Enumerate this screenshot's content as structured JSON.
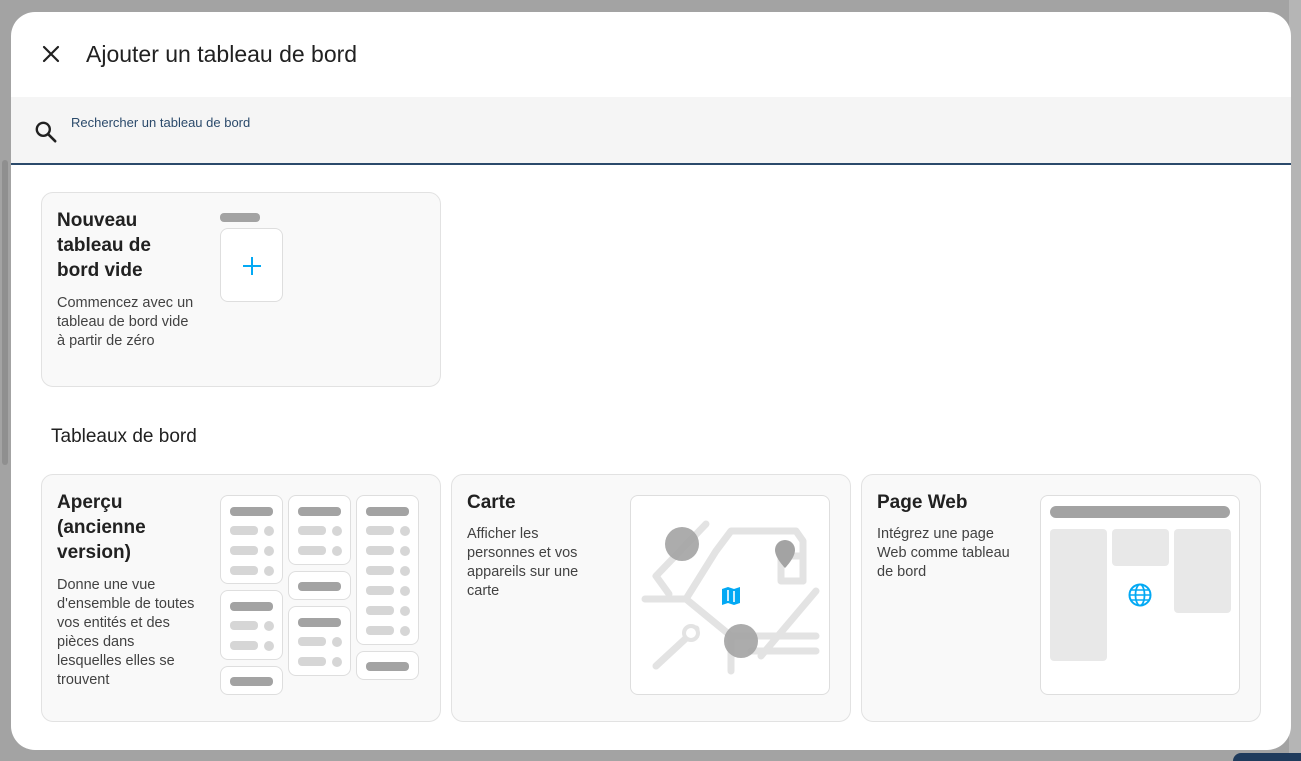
{
  "dialog": {
    "title": "Ajouter un tableau de bord",
    "search_placeholder": "Rechercher un tableau de bord"
  },
  "new_card": {
    "title": "Nouveau tableau de bord vide",
    "description": "Commencez avec un tableau de bord vide à partir de zéro"
  },
  "section": {
    "title": "Tableaux de bord"
  },
  "cards": [
    {
      "title": "Aperçu (ancienne version)",
      "description": "Donne une vue d'ensemble de toutes vos entités et des pièces dans lesquelles elles se trouvent"
    },
    {
      "title": "Carte",
      "description": "Afficher les personnes et vos appareils sur une carte"
    },
    {
      "title": "Page Web",
      "description": "Intégrez une page Web comme tableau de bord"
    }
  ],
  "colors": {
    "accent": "#03a9f4",
    "divider": "#2b4a6b"
  },
  "icons": {
    "close": "close-icon",
    "search": "search-icon",
    "add": "plus-icon",
    "map": "map-icon",
    "web": "globe-icon"
  }
}
